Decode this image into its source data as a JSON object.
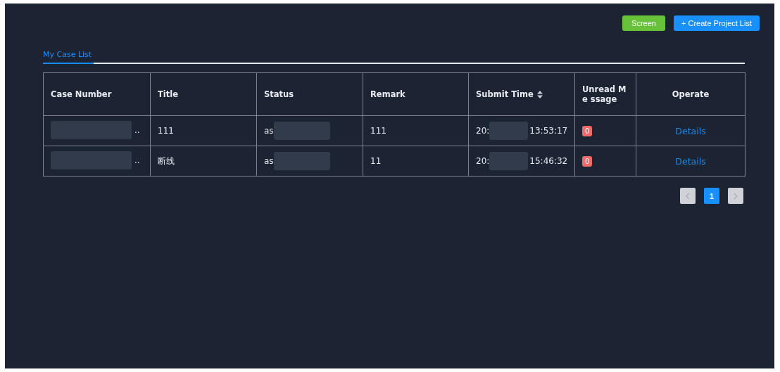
{
  "toolbar": {
    "buttons": [
      {
        "label": "Screen",
        "kind": "success"
      },
      {
        "label": "+ Create Project List",
        "kind": "primary"
      }
    ]
  },
  "tabs": [
    {
      "label": "My Case List",
      "selected": true
    }
  ],
  "table": {
    "columns": [
      {
        "label": "Case Number",
        "sortable": false
      },
      {
        "label": "Title",
        "sortable": false
      },
      {
        "label": "Status",
        "sortable": false
      },
      {
        "label": "Remark",
        "sortable": false
      },
      {
        "label": "Submit Time",
        "sortable": true
      },
      {
        "label": "Unread Me ssage",
        "sortable": false
      },
      {
        "label": "Operate",
        "sortable": false
      }
    ],
    "rows": [
      {
        "case_number": "..",
        "title": "111",
        "status": "as",
        "remark": "111",
        "submit_start": "20:",
        "submit_end": "13:53:17",
        "unread": "0",
        "action": "Details"
      },
      {
        "case_number": "..",
        "title": "断线",
        "status": "as",
        "remark": "11",
        "submit_start": "20:",
        "submit_end": "15:46:32",
        "unread": "0",
        "action": "Details"
      }
    ]
  },
  "pagination": {
    "prev_disabled": true,
    "next_disabled": true,
    "pages": [
      {
        "label": "1",
        "selected": true
      }
    ]
  }
}
